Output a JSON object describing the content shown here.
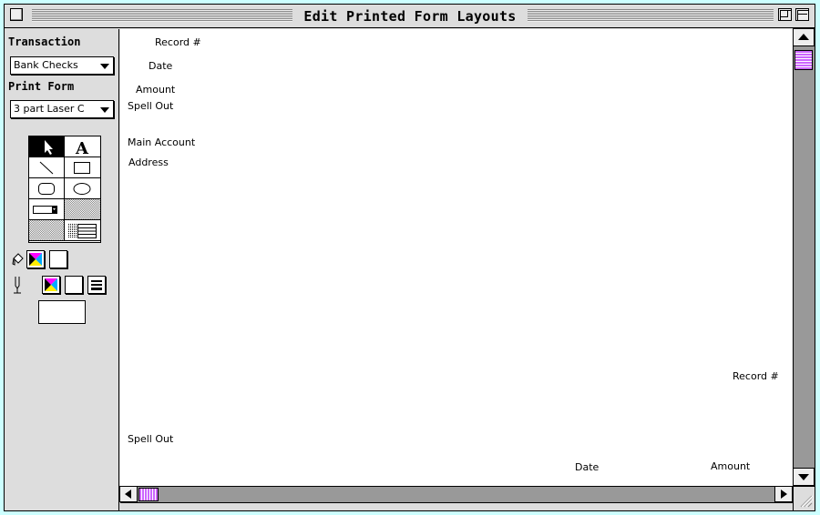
{
  "window": {
    "title": "Edit Printed Form Layouts"
  },
  "palette": {
    "transaction_label": "Transaction",
    "transaction_value": "Bank Checks",
    "print_form_label": "Print Form",
    "print_form_value": "3 part Laser C",
    "tools": [
      "arrow-tool",
      "text-tool",
      "line-tool",
      "rectangle-tool",
      "rounded-rectangle-tool",
      "oval-tool",
      "field-tool",
      "pattern-tool",
      "pattern-tool-2",
      "table-tool"
    ]
  },
  "fields": {
    "record_top": "Record #",
    "date_top": "Date",
    "amount_top": "Amount",
    "spell_out_top": "Spell Out",
    "main_account": "Main Account",
    "address": "Address",
    "record_bottom": "Record #",
    "spell_out_bottom": "Spell Out",
    "date_bottom": "Date",
    "amount_bottom": "Amount"
  },
  "colors": {
    "desktop": "#ccffff",
    "scroll_thumb": "#cc66ff",
    "scroll_track": "#999999"
  }
}
